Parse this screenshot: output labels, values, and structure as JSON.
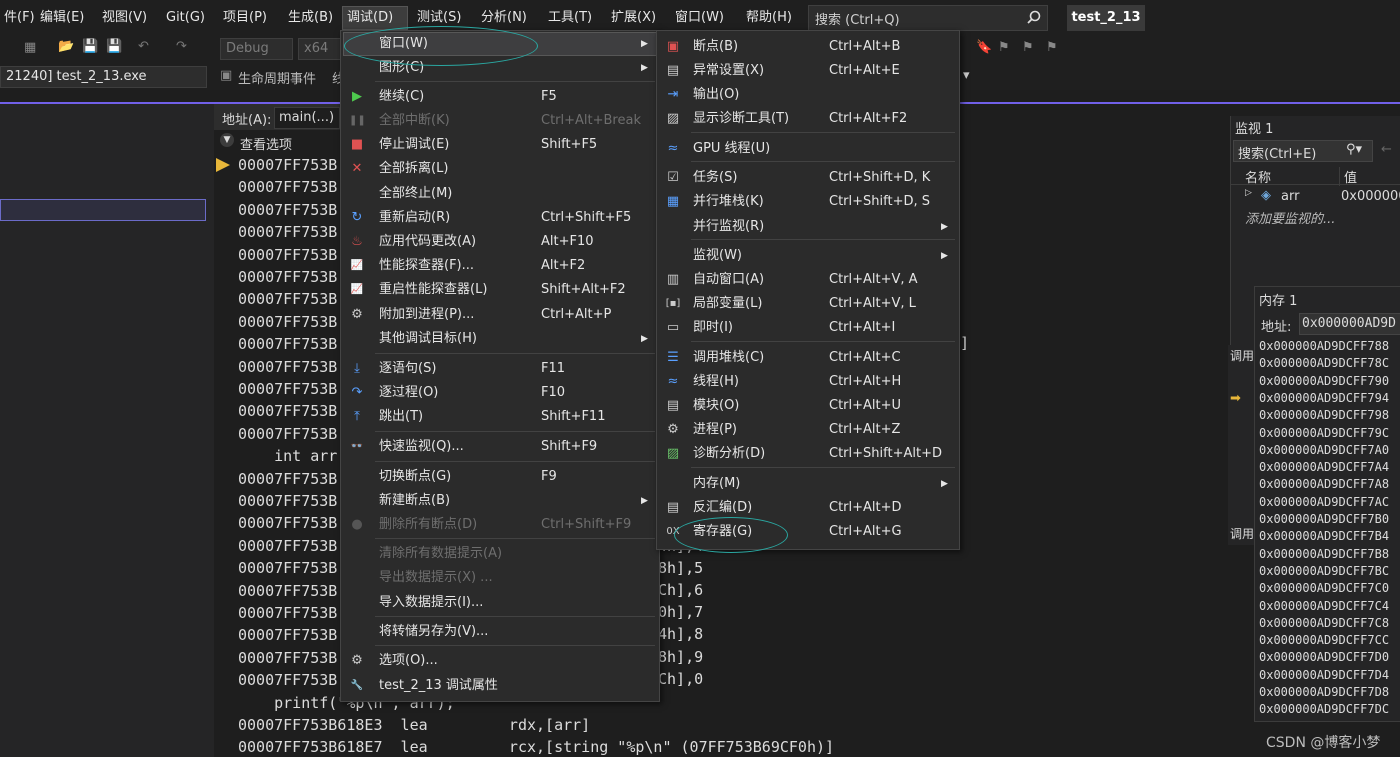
{
  "menubar": {
    "items": [
      "件(F)",
      "编辑(E)",
      "视图(V)",
      "Git(G)",
      "项目(P)",
      "生成(B)",
      "调试(D)",
      "测试(S)",
      "分析(N)",
      "工具(T)",
      "扩展(X)",
      "窗口(W)",
      "帮助(H)"
    ],
    "search_placeholder": "搜索 (Ctrl+Q)",
    "project": "test_2_13"
  },
  "toolbar": {
    "config": "Debug",
    "platform": "x64",
    "process": "21240] test_2_13.exe",
    "lifecycle": "生命周期事件",
    "lifecycle_tail": "线"
  },
  "disasm": {
    "address_label": "地址(A):",
    "address_value": "main(...)",
    "view_options": "查看选项",
    "lines": [
      "00007FF753B",
      "00007FF753B",
      "00007FF753B",
      "00007FF753B",
      "00007FF753B",
      "00007FF753B",
      "00007FF753B",
      "00007FF753B",
      "00007FF753B",
      "00007FF753B",
      "00007FF753B",
      "00007FF753B",
      "00007FF753B",
      "    int arr",
      "00007FF753B",
      "00007FF753B",
      "00007FF753B",
      "00007FF753B",
      "00007FF753B",
      "00007FF753B",
      "00007FF753B",
      "00007FF753B",
      "00007FF753B",
      "00007FF753B",
      "    printf(\"%p\\n\", arr);",
      "00007FF753B618E3  lea         rdx,[arr]",
      "00007FF753B618E7  lea         rcx,[string \"%p\\n\" (07FF753B69CF0h)]"
    ],
    "tails": [
      "4h],4",
      "8h],5",
      "Ch],6",
      "0h],7",
      "4h],8",
      "8h],9",
      "Ch],0",
      "]"
    ]
  },
  "debug_menu": {
    "items": [
      {
        "label": "窗口(W)",
        "shortcut": "",
        "sub": true,
        "enabled": true,
        "icon": ""
      },
      {
        "label": "图形(C)",
        "shortcut": "",
        "sub": true,
        "enabled": true,
        "icon": ""
      },
      {
        "label": "继续(C)",
        "shortcut": "F5",
        "sub": false,
        "enabled": true,
        "icon": "play-icon"
      },
      {
        "label": "全部中断(K)",
        "shortcut": "Ctrl+Alt+Break",
        "sub": false,
        "enabled": false,
        "icon": "pause-icon"
      },
      {
        "label": "停止调试(E)",
        "shortcut": "Shift+F5",
        "sub": false,
        "enabled": true,
        "icon": "stop-icon"
      },
      {
        "label": "全部拆离(L)",
        "shortcut": "",
        "sub": false,
        "enabled": true,
        "icon": "detach-icon"
      },
      {
        "label": "全部终止(M)",
        "shortcut": "",
        "sub": false,
        "enabled": true,
        "icon": ""
      },
      {
        "label": "重新启动(R)",
        "shortcut": "Ctrl+Shift+F5",
        "sub": false,
        "enabled": true,
        "icon": "restart-icon"
      },
      {
        "label": "应用代码更改(A)",
        "shortcut": "Alt+F10",
        "sub": false,
        "enabled": true,
        "icon": "hot-reload-icon"
      },
      {
        "label": "性能探查器(F)...",
        "shortcut": "Alt+F2",
        "sub": false,
        "enabled": true,
        "icon": "profiler-icon"
      },
      {
        "label": "重启性能探查器(L)",
        "shortcut": "Shift+Alt+F2",
        "sub": false,
        "enabled": true,
        "icon": "profiler-restart-icon"
      },
      {
        "label": "附加到进程(P)...",
        "shortcut": "Ctrl+Alt+P",
        "sub": false,
        "enabled": true,
        "icon": "attach-gear-icon"
      },
      {
        "label": "其他调试目标(H)",
        "shortcut": "",
        "sub": true,
        "enabled": true,
        "icon": ""
      },
      {
        "label": "逐语句(S)",
        "shortcut": "F11",
        "sub": false,
        "enabled": true,
        "icon": "step-into-icon"
      },
      {
        "label": "逐过程(O)",
        "shortcut": "F10",
        "sub": false,
        "enabled": true,
        "icon": "step-over-icon"
      },
      {
        "label": "跳出(T)",
        "shortcut": "Shift+F11",
        "sub": false,
        "enabled": true,
        "icon": "step-out-icon"
      },
      {
        "label": "快速监视(Q)...",
        "shortcut": "Shift+F9",
        "sub": false,
        "enabled": true,
        "icon": "glasses-icon"
      },
      {
        "label": "切换断点(G)",
        "shortcut": "F9",
        "sub": false,
        "enabled": true,
        "icon": ""
      },
      {
        "label": "新建断点(B)",
        "shortcut": "",
        "sub": true,
        "enabled": true,
        "icon": ""
      },
      {
        "label": "删除所有断点(D)",
        "shortcut": "Ctrl+Shift+F9",
        "sub": false,
        "enabled": false,
        "icon": "delete-breakpoints-icon"
      },
      {
        "label": "清除所有数据提示(A)",
        "shortcut": "",
        "sub": false,
        "enabled": false,
        "icon": ""
      },
      {
        "label": "导出数据提示(X) ...",
        "shortcut": "",
        "sub": false,
        "enabled": false,
        "icon": ""
      },
      {
        "label": "导入数据提示(I)...",
        "shortcut": "",
        "sub": false,
        "enabled": true,
        "icon": ""
      },
      {
        "label": "将转储另存为(V)...",
        "shortcut": "",
        "sub": false,
        "enabled": true,
        "icon": ""
      },
      {
        "label": "选项(O)...",
        "shortcut": "",
        "sub": false,
        "enabled": true,
        "icon": "gear-icon"
      },
      {
        "label": "test_2_13 调试属性",
        "shortcut": "",
        "sub": false,
        "enabled": true,
        "icon": "wrench-icon"
      }
    ]
  },
  "window_submenu": {
    "items": [
      {
        "label": "断点(B)",
        "shortcut": "Ctrl+Alt+B",
        "sub": false,
        "icon": "breakpoints-icon"
      },
      {
        "label": "异常设置(X)",
        "shortcut": "Ctrl+Alt+E",
        "sub": false,
        "icon": "exception-icon"
      },
      {
        "label": "输出(O)",
        "shortcut": "",
        "sub": false,
        "icon": "output-icon"
      },
      {
        "label": "显示诊断工具(T)",
        "shortcut": "Ctrl+Alt+F2",
        "sub": false,
        "icon": "diagnostics-icon"
      },
      {
        "label": "GPU 线程(U)",
        "shortcut": "",
        "sub": false,
        "icon": "gpu-threads-icon"
      },
      {
        "label": "任务(S)",
        "shortcut": "Ctrl+Shift+D, K",
        "sub": false,
        "icon": "tasks-icon"
      },
      {
        "label": "并行堆栈(K)",
        "shortcut": "Ctrl+Shift+D, S",
        "sub": false,
        "icon": "parallel-stacks-icon"
      },
      {
        "label": "并行监视(R)",
        "shortcut": "",
        "sub": true,
        "icon": ""
      },
      {
        "label": "监视(W)",
        "shortcut": "",
        "sub": true,
        "icon": ""
      },
      {
        "label": "自动窗口(A)",
        "shortcut": "Ctrl+Alt+V, A",
        "sub": false,
        "icon": "autos-icon"
      },
      {
        "label": "局部变量(L)",
        "shortcut": "Ctrl+Alt+V, L",
        "sub": false,
        "icon": "locals-icon"
      },
      {
        "label": "即时(I)",
        "shortcut": "Ctrl+Alt+I",
        "sub": false,
        "icon": "immediate-icon"
      },
      {
        "label": "调用堆栈(C)",
        "shortcut": "Ctrl+Alt+C",
        "sub": false,
        "icon": "call-stack-icon"
      },
      {
        "label": "线程(H)",
        "shortcut": "Ctrl+Alt+H",
        "sub": false,
        "icon": "threads-icon"
      },
      {
        "label": "模块(O)",
        "shortcut": "Ctrl+Alt+U",
        "sub": false,
        "icon": "modules-icon"
      },
      {
        "label": "进程(P)",
        "shortcut": "Ctrl+Alt+Z",
        "sub": false,
        "icon": "processes-icon"
      },
      {
        "label": "诊断分析(D)",
        "shortcut": "Ctrl+Shift+Alt+D",
        "sub": false,
        "icon": "diagnostic-analysis-icon"
      },
      {
        "label": "内存(M)",
        "shortcut": "",
        "sub": true,
        "icon": ""
      },
      {
        "label": "反汇编(D)",
        "shortcut": "Ctrl+Alt+D",
        "sub": false,
        "icon": "disassembly-icon"
      },
      {
        "label": "寄存器(G)",
        "shortcut": "Ctrl+Alt+G",
        "sub": false,
        "icon": "registers-icon"
      }
    ]
  },
  "watch": {
    "title": "监视 1",
    "search": "搜索(Ctrl+E)",
    "col_name": "名称",
    "col_value": "值",
    "var_name": "arr",
    "var_value": "0x0000000",
    "add_hint": "添加要监视的..."
  },
  "memory": {
    "title": "内存 1",
    "addr_label": "地址:",
    "addr_value": "0x000000AD9D",
    "rows": [
      "0x000000AD9DCFF788",
      "0x000000AD9DCFF78C",
      "0x000000AD9DCFF790",
      "0x000000AD9DCFF794",
      "0x000000AD9DCFF798",
      "0x000000AD9DCFF79C",
      "0x000000AD9DCFF7A0",
      "0x000000AD9DCFF7A4",
      "0x000000AD9DCFF7A8",
      "0x000000AD9DCFF7AC",
      "0x000000AD9DCFF7B0",
      "0x000000AD9DCFF7B4",
      "0x000000AD9DCFF7B8",
      "0x000000AD9DCFF7BC",
      "0x000000AD9DCFF7C0",
      "0x000000AD9DCFF7C4",
      "0x000000AD9DCFF7C8",
      "0x000000AD9DCFF7CC",
      "0x000000AD9DCFF7D0",
      "0x000000AD9DCFF7D4",
      "0x000000AD9DCFF7D8",
      "0x000000AD9DCFF7DC"
    ]
  },
  "callstack": {
    "title": "调用",
    "title2": "调用"
  },
  "watermark": "CSDN @博客小梦"
}
